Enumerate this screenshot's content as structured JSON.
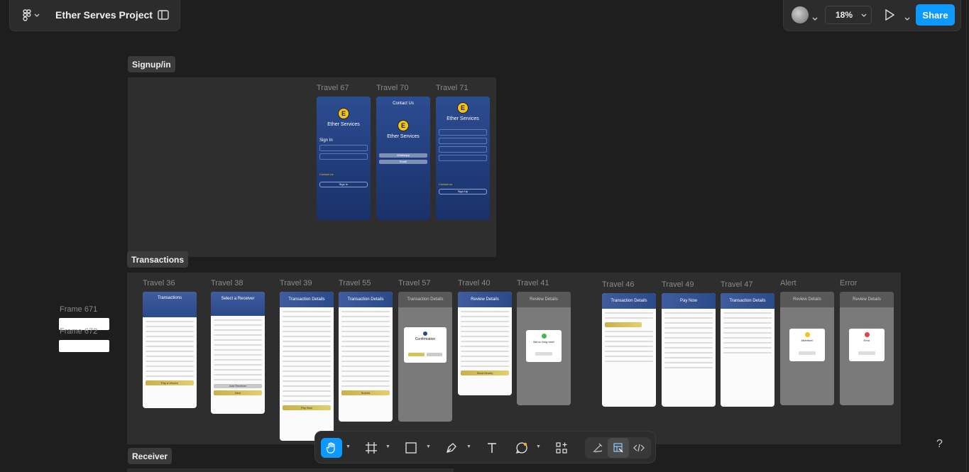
{
  "header": {
    "project_title": "Ether Serves Project",
    "zoom_label": "18%",
    "share_label": "Share"
  },
  "icons": {
    "menu": "figma-menu-icon",
    "panel": "sidebar-toggle-icon",
    "play": "present-play-icon",
    "help": "help-icon"
  },
  "colors": {
    "accent": "#0d99ff",
    "canvas": "#1e1e1e",
    "section": "#2e2e2e",
    "brand_blue": "#2d4d92",
    "gold": "#e1cf72"
  },
  "sections": {
    "signup": {
      "label": "Signup/in",
      "frames": [
        {
          "label": "Travel 67",
          "brand": "Ether Services",
          "title": "Sign In",
          "button": "Sign In",
          "contact": "Contact Us"
        },
        {
          "label": "Travel 70",
          "title": "Contact Us",
          "brand": "Ether Services",
          "btn1": "Whatsapp",
          "btn2": "Email"
        },
        {
          "label": "Travel 71",
          "brand": "Ether Services",
          "button": "Sign Up",
          "contact": "Contact us"
        }
      ]
    },
    "transactions": {
      "label": "Transactions",
      "frames": [
        {
          "label": "Travel 36",
          "title": "Transactions",
          "button": "Pay a Vendor"
        },
        {
          "label": "Travel 38",
          "title": "Select a Receiver",
          "button": "Add Receiver",
          "button2": "Next"
        },
        {
          "label": "Travel 39",
          "title": "Transaction Details",
          "button": "Pay Now"
        },
        {
          "label": "Travel 55",
          "title": "Transaction Details",
          "button": "Submit"
        },
        {
          "label": "Travel 57",
          "title": "Transaction Details",
          "modal_title": "Confirmation"
        },
        {
          "label": "Travel 40",
          "title": "Review Details",
          "button": "Send Money"
        },
        {
          "label": "Travel 41",
          "title": "Review Details",
          "modal_title": "Not so long now!"
        },
        {
          "label": "Travel 46",
          "title": "Transaction Details"
        },
        {
          "label": "Travel 49",
          "title": "Pay Now"
        },
        {
          "label": "Travel 47",
          "title": "Transaction Details"
        },
        {
          "label": "Alert",
          "title": "Review Details",
          "modal_title": "Attention!"
        },
        {
          "label": "Error",
          "title": "Review Details",
          "modal_title": "Error"
        }
      ]
    },
    "side_frames": [
      {
        "label": "Frame 671"
      },
      {
        "label": "Frame 672"
      }
    ],
    "receiver": {
      "label": "Receiver"
    }
  },
  "help_label": "?"
}
